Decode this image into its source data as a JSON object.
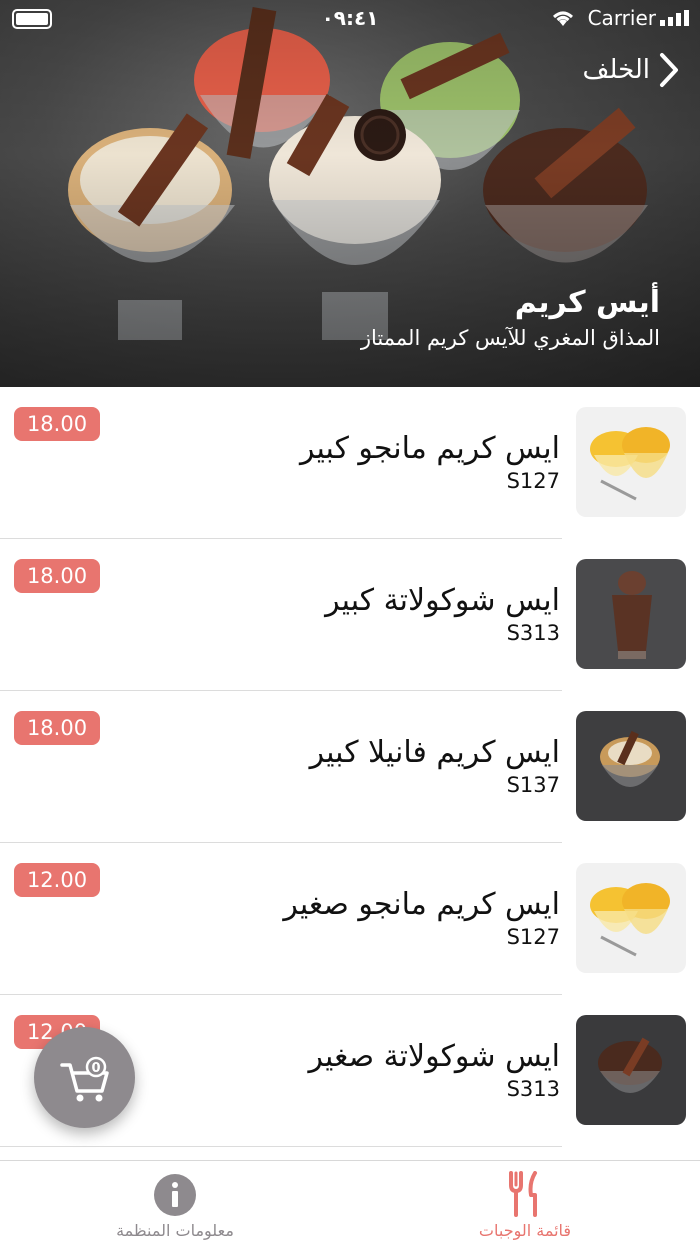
{
  "status": {
    "time": "٠٩:٤١",
    "carrier": "Carrier"
  },
  "nav": {
    "back_label": "الخلف"
  },
  "hero": {
    "title": "أيس كريم",
    "subtitle": "المذاق المغري للآيس كريم الممتاز"
  },
  "items": [
    {
      "name": "ايس كريم مانجو كبير",
      "code": "S127",
      "price": "18.00",
      "thumb": "mango"
    },
    {
      "name": "ايس شوكولاتة كبير",
      "code": "S313",
      "price": "18.00",
      "thumb": "choco-shake"
    },
    {
      "name": "ايس كريم فانيلا كبير",
      "code": "S137",
      "price": "18.00",
      "thumb": "vanilla"
    },
    {
      "name": "ايس كريم مانجو صغير",
      "code": "S127",
      "price": "12.00",
      "thumb": "mango"
    },
    {
      "name": "ايس شوكولاتة صغير",
      "code": "S313",
      "price": "12.00",
      "thumb": "choco-scoop"
    }
  ],
  "cart": {
    "count": "0"
  },
  "tabs": [
    {
      "label": "قائمة الوجبات",
      "icon": "fork-knife-icon",
      "active": true,
      "color": "#e8756f"
    },
    {
      "label": "معلومات المنظمة",
      "icon": "info-icon",
      "active": false,
      "color": "#8e8a8e"
    }
  ]
}
